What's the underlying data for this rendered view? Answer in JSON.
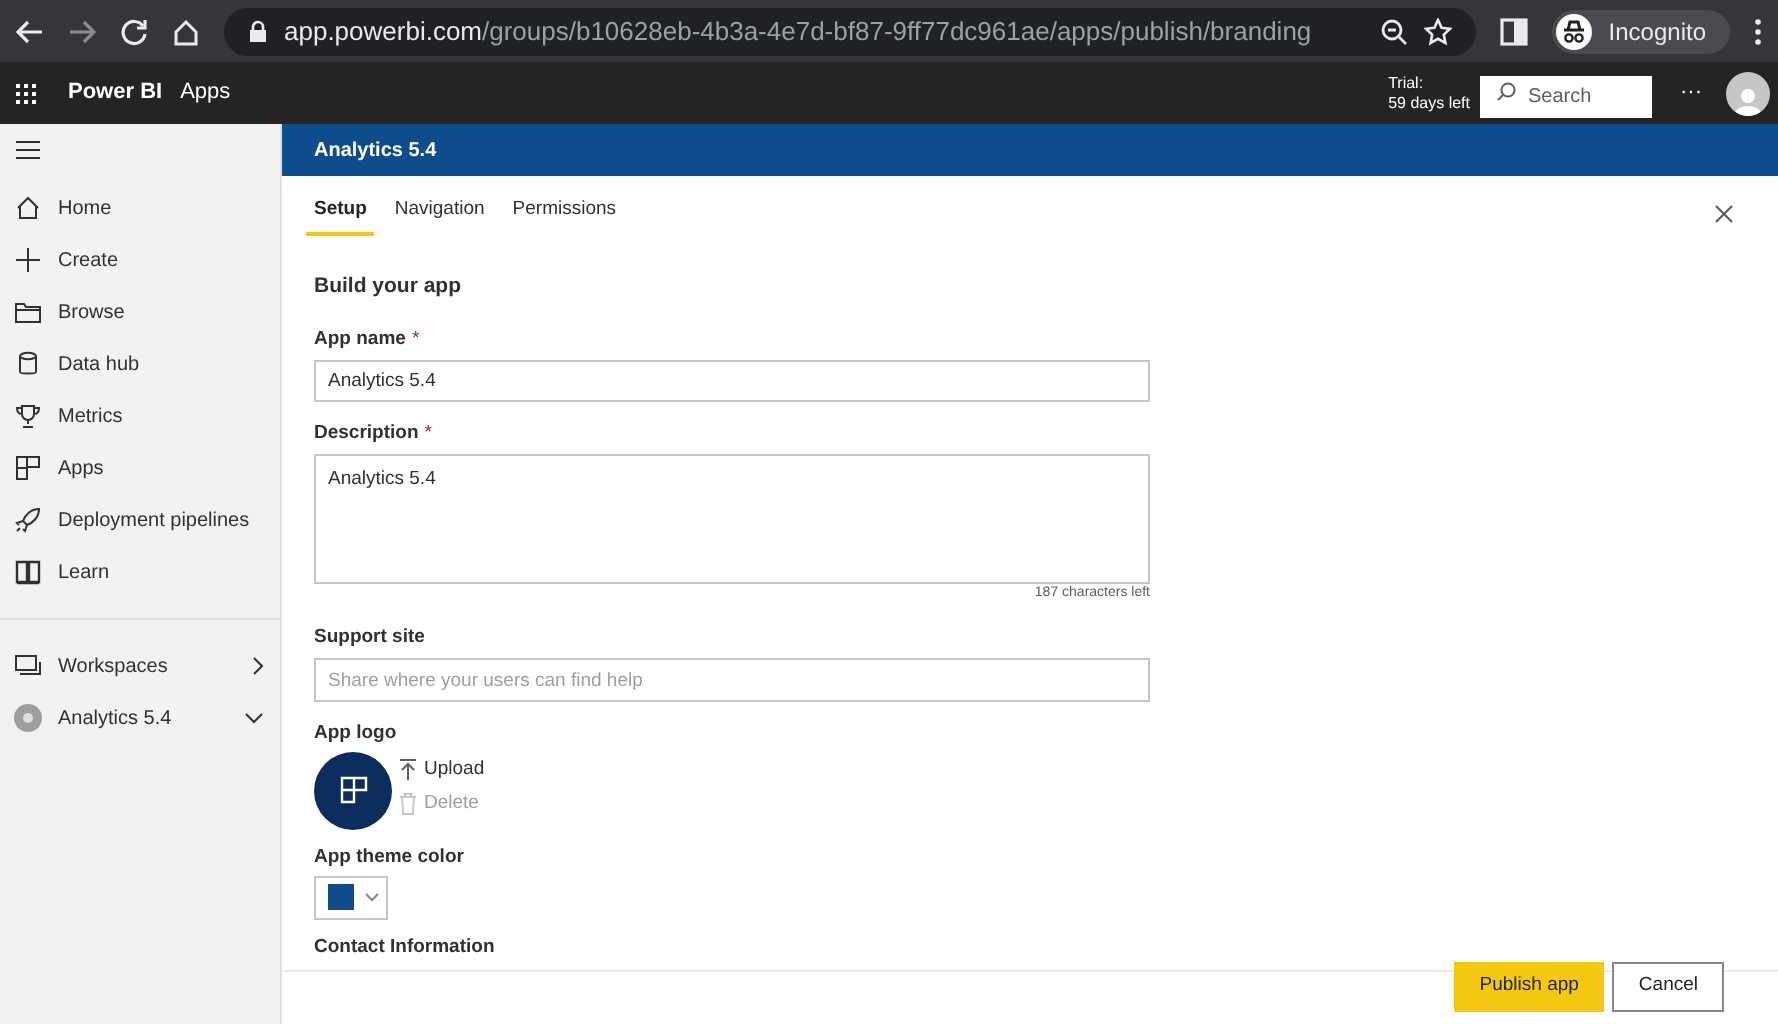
{
  "browser": {
    "url_host": "app.powerbi.com",
    "url_path": "/groups/b10628eb-4b3a-4e7d-bf87-9ff77dc961ae/apps/publish/branding",
    "profile": "Incognito"
  },
  "app_bar": {
    "brand": "Power BI",
    "section": "Apps",
    "trial_label": "Trial:",
    "trial_days": "59 days left",
    "search": {
      "placeholder": "Search"
    },
    "more": "···"
  },
  "sidebar": {
    "items": [
      {
        "label": "Home"
      },
      {
        "label": "Create"
      },
      {
        "label": "Browse"
      },
      {
        "label": "Data hub"
      },
      {
        "label": "Metrics"
      },
      {
        "label": "Apps"
      },
      {
        "label": "Deployment pipelines"
      },
      {
        "label": "Learn"
      }
    ],
    "workspaces": [
      {
        "label": "Workspaces",
        "expanded": false
      },
      {
        "label": "Analytics 5.4",
        "expanded": true
      }
    ]
  },
  "panel": {
    "title": "Analytics 5.4",
    "tabs": [
      {
        "label": "Setup",
        "selected": true
      },
      {
        "label": "Navigation",
        "selected": false
      },
      {
        "label": "Permissions",
        "selected": false
      }
    ],
    "heading": "Build your app",
    "app_name": {
      "label": "App name",
      "required_mark": "*",
      "value": "Analytics 5.4"
    },
    "description": {
      "label": "Description",
      "required_mark": "*",
      "value": "Analytics 5.4",
      "counter": "187 characters left"
    },
    "support_site": {
      "label": "Support site",
      "placeholder": "Share where your users can find help"
    },
    "app_logo": {
      "label": "App logo",
      "upload": "Upload",
      "delete": {
        "label": "Delete",
        "disabled": true
      }
    },
    "theme_color": {
      "label": "App theme color",
      "color": "#0f4c8c"
    },
    "contact_heading": "Contact Information",
    "buttons": [
      {
        "label": "Publish app",
        "kind": "primary"
      },
      {
        "label": "Cancel",
        "kind": "secondary"
      }
    ]
  }
}
